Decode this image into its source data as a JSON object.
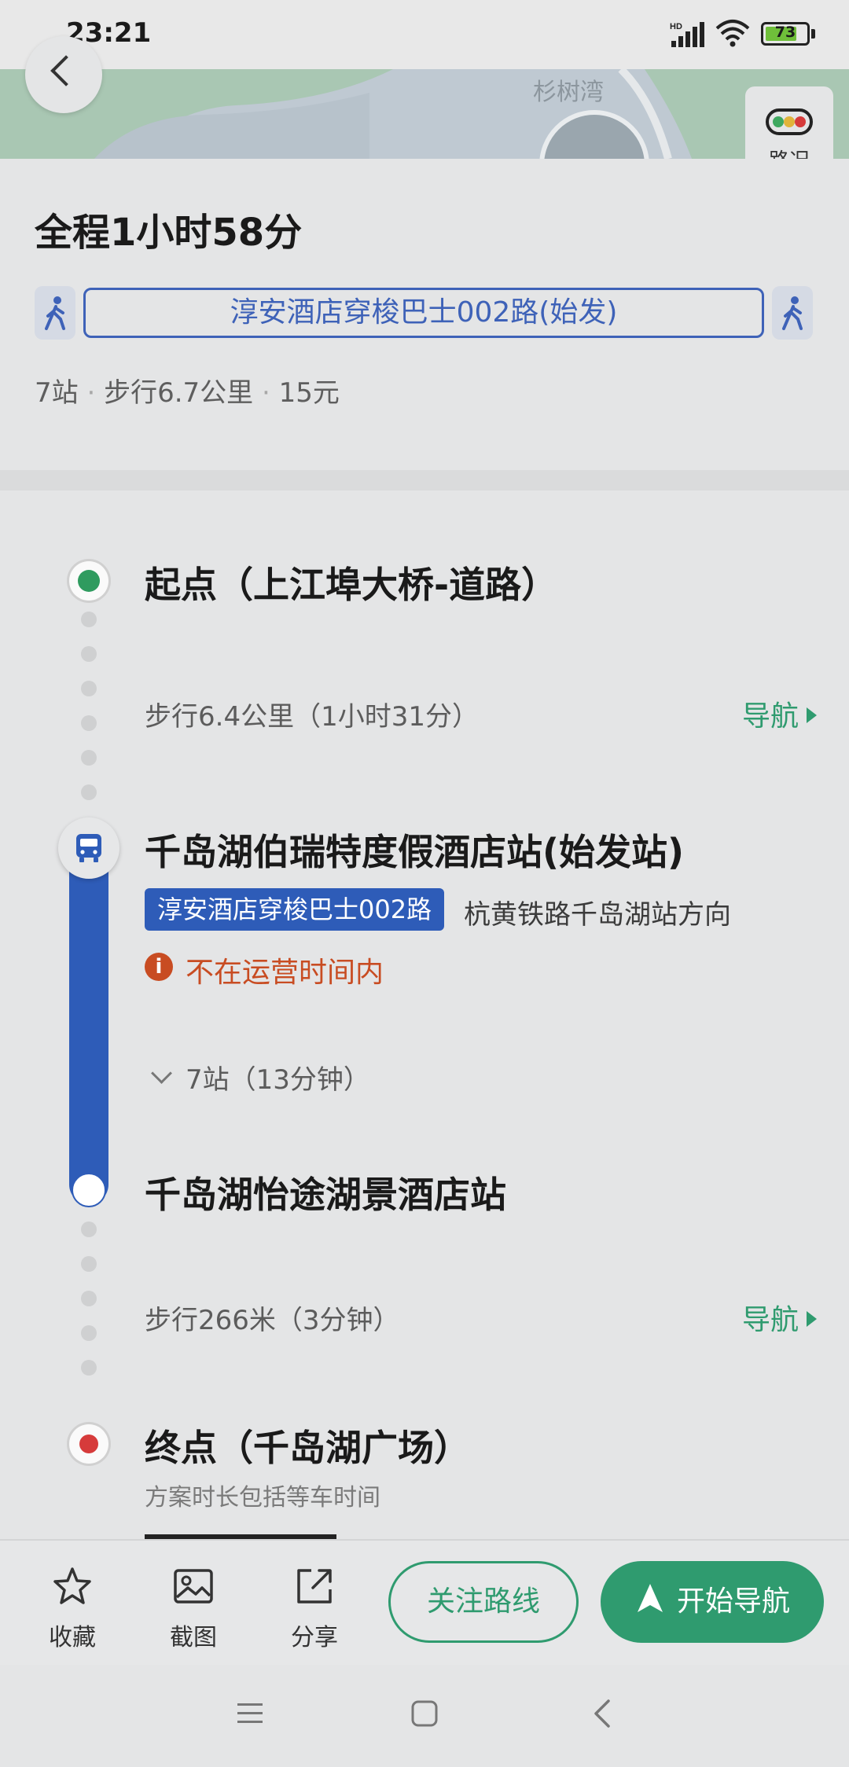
{
  "status_bar": {
    "time": "23:21",
    "network": "HD",
    "battery": "73"
  },
  "map": {
    "place_label": "杉树湾",
    "traffic_label": "路况"
  },
  "summary": {
    "total_time": "全程1小时58分",
    "route_name": "淳安酒店穿梭巴士002路(始发)",
    "stops": "7站",
    "walk": "步行6.7公里",
    "fare": "15元"
  },
  "timeline": {
    "start": "起点（上江埠大桥-道路）",
    "walk1": "步行6.4公里（1小时31分）",
    "nav_label": "导航",
    "board_station": "千岛湖伯瑞特度假酒店站(始发站)",
    "line_name": "淳安酒店穿梭巴士002路",
    "direction": "杭黄铁路千岛湖站方向",
    "warning": "不在运营时间内",
    "stops_info": "7站（13分钟）",
    "alight_station": "千岛湖怡途湖景酒店站",
    "walk2": "步行266米（3分钟）",
    "end": "终点（千岛湖广场）",
    "note": "方案时长包括等车时间"
  },
  "actions": {
    "favorite": "收藏",
    "screenshot": "截图",
    "share": "分享",
    "follow_route": "关注路线",
    "start_navigation": "开始导航"
  },
  "colors": {
    "accent_green": "#2f9b6f",
    "bus_blue": "#2e5cb8",
    "warning": "#c84c22"
  }
}
